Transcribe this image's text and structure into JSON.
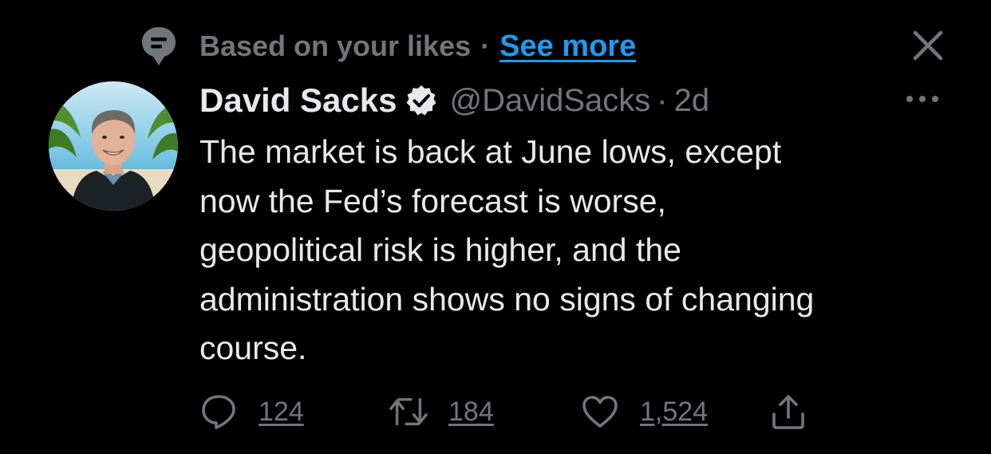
{
  "context": {
    "icon": "speech-bubble-icon",
    "text": "Based on your likes",
    "separator": "·",
    "see_more_label": "See more",
    "close_icon": "close-icon"
  },
  "author": {
    "display_name": "David Sacks",
    "verified_icon": "verified-badge-icon",
    "handle": "@DavidSacks",
    "separator": "·",
    "time": "2d",
    "more_icon": "more-options-icon"
  },
  "tweet": {
    "lines": [
      "The market is back at June lows, except",
      "now the Fed’s forecast is worse,",
      "geopolitical risk is higher, and the",
      "administration shows no signs of changing",
      "course."
    ]
  },
  "actions": {
    "reply_count": "124",
    "retweet_count": "184",
    "like_count": "1,524",
    "share_icon": "share-icon"
  },
  "colors": {
    "background": "#000000",
    "primary_text": "#e7e9ea",
    "secondary_text": "#71767b",
    "link": "#1d9bf0"
  }
}
